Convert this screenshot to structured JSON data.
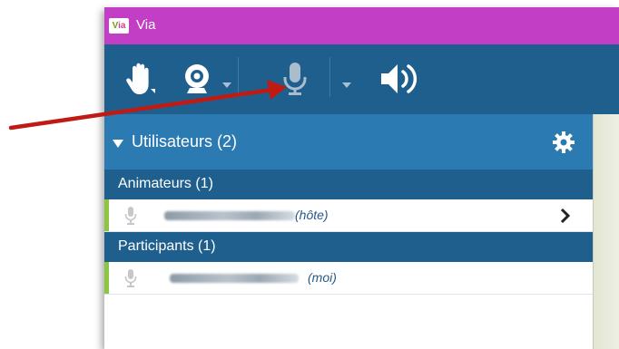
{
  "window": {
    "logo_text": "Via",
    "title": "Via"
  },
  "toolbar": {
    "buttons": [
      {
        "name": "raise-hand",
        "icon": "hand-icon"
      },
      {
        "name": "webcam",
        "icon": "webcam-icon"
      },
      {
        "name": "microphone",
        "icon": "microphone-icon"
      },
      {
        "name": "speaker",
        "icon": "speaker-icon"
      }
    ]
  },
  "users_panel": {
    "title": "Utilisateurs (2)",
    "settings_icon": "gear-icon",
    "sections": [
      {
        "label": "Animateurs (1)",
        "users": [
          {
            "name_hidden": true,
            "role": "(hôte)",
            "mic_icon": "microphone-icon",
            "has_chevron": true
          }
        ]
      },
      {
        "label": "Participants (1)",
        "users": [
          {
            "name_hidden": true,
            "role": "(moi)",
            "mic_icon": "microphone-icon",
            "has_chevron": false
          }
        ]
      }
    ]
  },
  "colors": {
    "titlebar": "#c23fc5",
    "toolbar": "#1f5f8e",
    "users_header": "#2b7ab1",
    "section_header": "#1f5f8e",
    "row_accent": "#8cc63f",
    "arrow": "#c01a14"
  }
}
